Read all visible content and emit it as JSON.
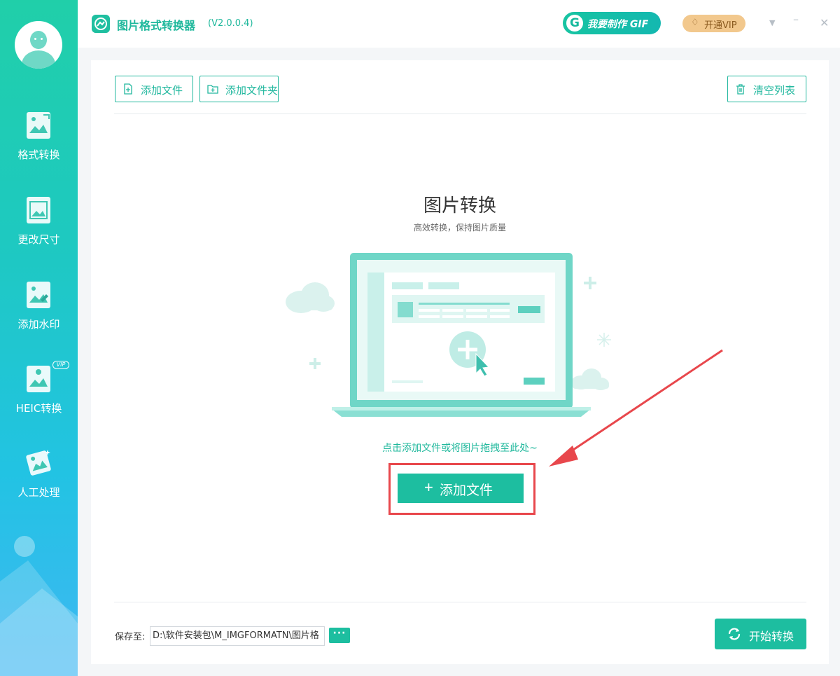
{
  "app": {
    "title": "图片格式转换器",
    "version": "(V2.0.0.4)",
    "gif_button": "我要制作 GIF",
    "gif_icon": "G",
    "vip_button": "开通VIP",
    "window_controls": {
      "menu": "▼",
      "minimize": "–",
      "close": "✕"
    }
  },
  "sidebar": {
    "items": [
      {
        "label": "格式转换",
        "icon": "image-convert-icon"
      },
      {
        "label": "更改尺寸",
        "icon": "image-resize-icon"
      },
      {
        "label": "添加水印",
        "icon": "image-watermark-icon"
      },
      {
        "label": "HEIC转换",
        "icon": "heic-convert-icon",
        "badge": "VIP"
      },
      {
        "label": "人工处理",
        "icon": "manual-process-icon"
      }
    ]
  },
  "toolbar": {
    "add_file": "添加文件",
    "add_folder": "添加文件夹",
    "clear_list": "清空列表"
  },
  "empty_state": {
    "title": "图片转换",
    "subtitle": "高效转换，保持图片质量",
    "hint": "点击添加文件或将图片拖拽至此处~",
    "add_button_plus": "+",
    "add_button": "添加文件"
  },
  "footer": {
    "save_label": "保存至:",
    "save_path": "D:\\软件安装包\\M_IMGFORMATN\\图片格",
    "more_button": "···",
    "start_button": "开始转换"
  },
  "colors": {
    "accent": "#1dbea0",
    "highlight": "#e8474c",
    "vip": "#f2c88d"
  }
}
